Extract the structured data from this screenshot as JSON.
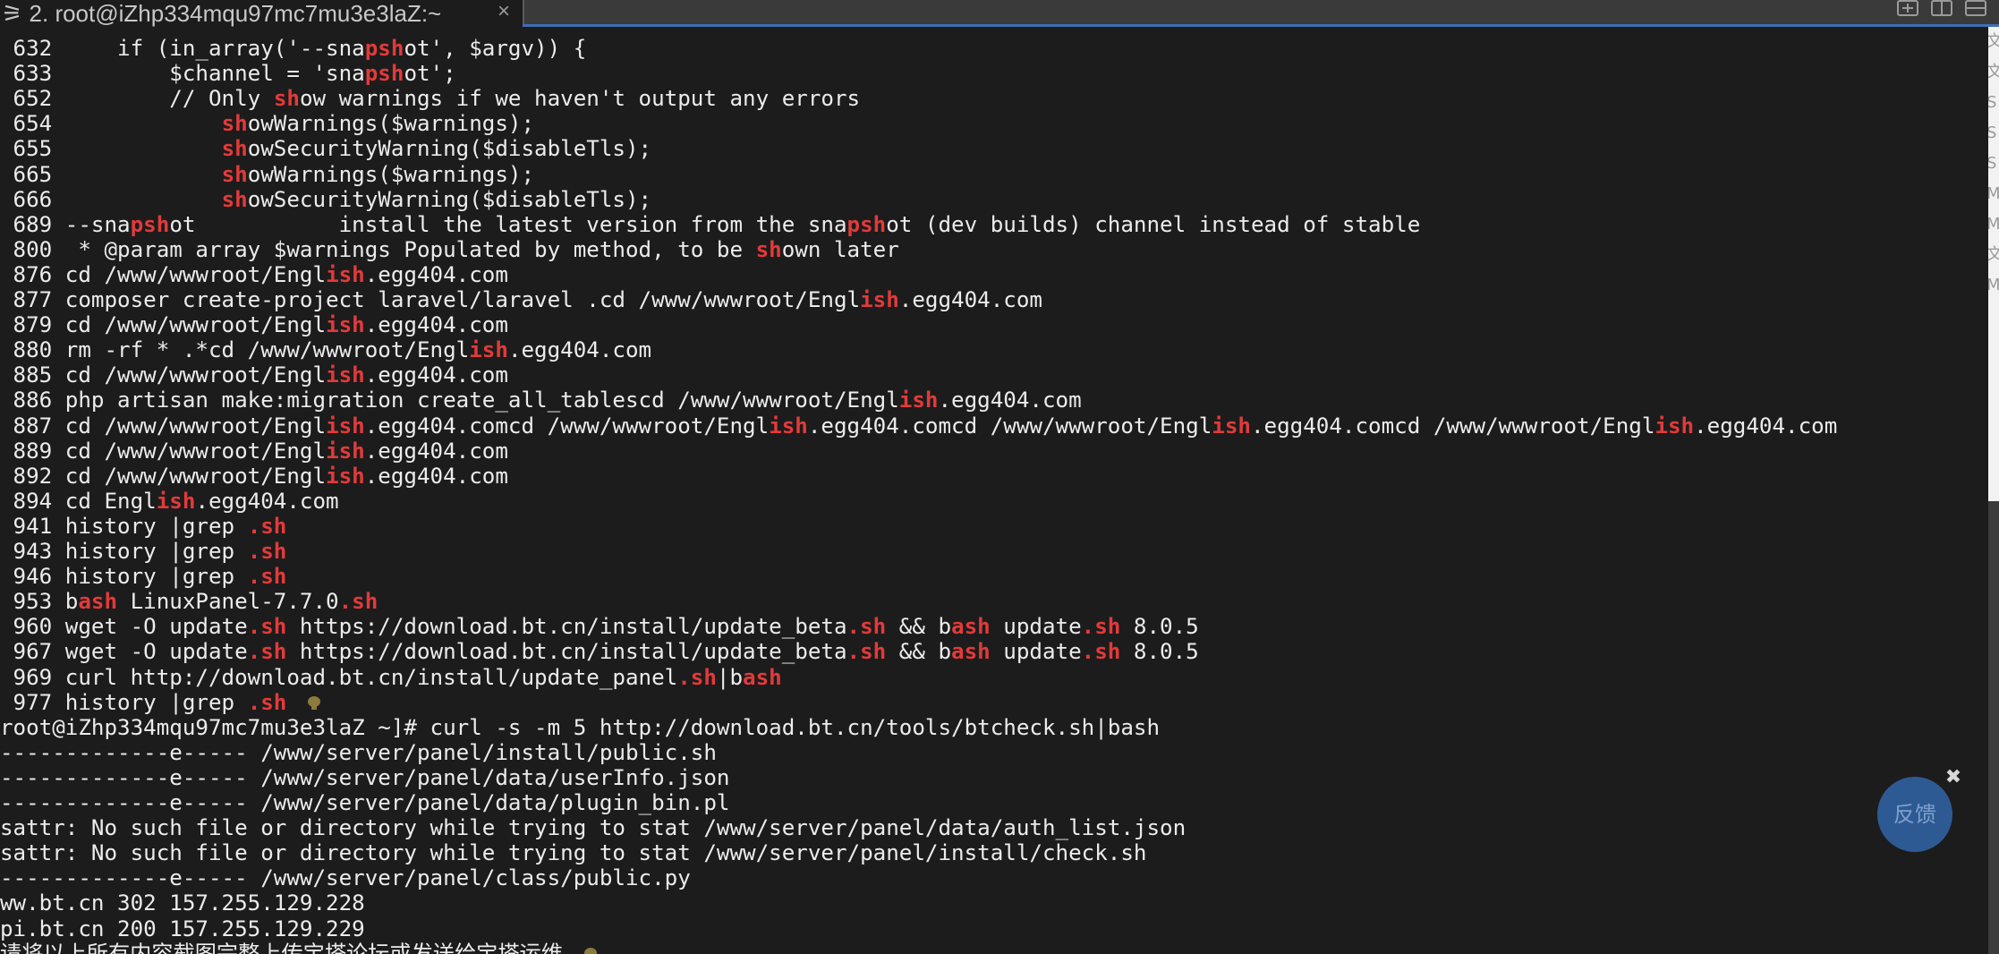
{
  "tab": {
    "prefix": "⚞",
    "title": " 2. root@iZhp334mqu97mc7mu3e3laZ:~",
    "close": "×"
  },
  "window_buttons": [
    "new-tab",
    "split-vertical",
    "split-horizontal"
  ],
  "terminal": {
    "history": [
      {
        "num": "632",
        "segments": [
          [
            "     if (in_array('--sna",
            0
          ],
          [
            "psh",
            1
          ],
          [
            "ot', $argv)) {",
            0
          ]
        ]
      },
      {
        "num": "633",
        "segments": [
          [
            "         $channel = 'sna",
            0
          ],
          [
            "psh",
            1
          ],
          [
            "ot';",
            0
          ]
        ]
      },
      {
        "num": "652",
        "segments": [
          [
            "         // Only ",
            0
          ],
          [
            "sh",
            1
          ],
          [
            "ow warnings if we haven't output any errors",
            0
          ]
        ]
      },
      {
        "num": "654",
        "segments": [
          [
            "             ",
            0
          ],
          [
            "sh",
            1
          ],
          [
            "owWarnings($warnings);",
            0
          ]
        ]
      },
      {
        "num": "655",
        "segments": [
          [
            "             ",
            0
          ],
          [
            "sh",
            1
          ],
          [
            "owSecurityWarning($disableTls);",
            0
          ]
        ]
      },
      {
        "num": "665",
        "segments": [
          [
            "             ",
            0
          ],
          [
            "sh",
            1
          ],
          [
            "owWarnings($warnings);",
            0
          ]
        ]
      },
      {
        "num": "666",
        "segments": [
          [
            "             ",
            0
          ],
          [
            "sh",
            1
          ],
          [
            "owSecurityWarning($disableTls);",
            0
          ]
        ]
      },
      {
        "num": "689",
        "segments": [
          [
            " --sna",
            0
          ],
          [
            "psh",
            1
          ],
          [
            "ot           install the latest version from the sna",
            0
          ],
          [
            "psh",
            1
          ],
          [
            "ot (dev builds) channel instead of stable",
            0
          ]
        ]
      },
      {
        "num": "800",
        "segments": [
          [
            "  * @param array $warnings Populated by method, to be ",
            0
          ],
          [
            "sh",
            1
          ],
          [
            "own later",
            0
          ]
        ]
      },
      {
        "num": "876",
        "segments": [
          [
            " cd /www/wwwroot/Engl",
            0
          ],
          [
            "ish",
            1
          ],
          [
            ".egg404.com",
            0
          ]
        ]
      },
      {
        "num": "877",
        "segments": [
          [
            " composer create-project laravel/laravel .cd /www/wwwroot/Engl",
            0
          ],
          [
            "ish",
            1
          ],
          [
            ".egg404.com",
            0
          ]
        ]
      },
      {
        "num": "879",
        "segments": [
          [
            " cd /www/wwwroot/Engl",
            0
          ],
          [
            "ish",
            1
          ],
          [
            ".egg404.com",
            0
          ]
        ]
      },
      {
        "num": "880",
        "segments": [
          [
            " rm -rf * .*cd /www/wwwroot/Engl",
            0
          ],
          [
            "ish",
            1
          ],
          [
            ".egg404.com",
            0
          ]
        ]
      },
      {
        "num": "885",
        "segments": [
          [
            " cd /www/wwwroot/Engl",
            0
          ],
          [
            "ish",
            1
          ],
          [
            ".egg404.com",
            0
          ]
        ]
      },
      {
        "num": "886",
        "segments": [
          [
            " php artisan make:migration create_all_tablescd /www/wwwroot/Engl",
            0
          ],
          [
            "ish",
            1
          ],
          [
            ".egg404.com",
            0
          ]
        ]
      },
      {
        "num": "887",
        "segments": [
          [
            " cd /www/wwwroot/Engl",
            0
          ],
          [
            "ish",
            1
          ],
          [
            ".egg404.comcd /www/wwwroot/Engl",
            0
          ],
          [
            "ish",
            1
          ],
          [
            ".egg404.comcd /www/wwwroot/Engl",
            0
          ],
          [
            "ish",
            1
          ],
          [
            ".egg404.comcd /www/wwwroot/Engl",
            0
          ],
          [
            "ish",
            1
          ],
          [
            ".egg404.com",
            0
          ]
        ]
      },
      {
        "num": "889",
        "segments": [
          [
            " cd /www/wwwroot/Engl",
            0
          ],
          [
            "ish",
            1
          ],
          [
            ".egg404.com",
            0
          ]
        ]
      },
      {
        "num": "892",
        "segments": [
          [
            " cd /www/wwwroot/Engl",
            0
          ],
          [
            "ish",
            1
          ],
          [
            ".egg404.com",
            0
          ]
        ]
      },
      {
        "num": "894",
        "segments": [
          [
            " cd Engl",
            0
          ],
          [
            "ish",
            1
          ],
          [
            ".egg404.com",
            0
          ]
        ]
      },
      {
        "num": "941",
        "segments": [
          [
            " history |grep ",
            0
          ],
          [
            ".sh",
            1
          ]
        ]
      },
      {
        "num": "943",
        "segments": [
          [
            " history |grep ",
            0
          ],
          [
            ".sh",
            1
          ]
        ]
      },
      {
        "num": "946",
        "segments": [
          [
            " history |grep ",
            0
          ],
          [
            ".sh",
            1
          ]
        ]
      },
      {
        "num": "953",
        "segments": [
          [
            " b",
            0
          ],
          [
            "ash",
            1
          ],
          [
            " LinuxPanel-7.7.0",
            0
          ],
          [
            ".sh",
            1
          ]
        ]
      },
      {
        "num": "960",
        "segments": [
          [
            " wget -O update",
            0
          ],
          [
            ".sh",
            1
          ],
          [
            " https://download.bt.cn/install/update_beta",
            0
          ],
          [
            ".sh",
            1
          ],
          [
            " && b",
            0
          ],
          [
            "ash",
            1
          ],
          [
            " update",
            0
          ],
          [
            ".sh",
            1
          ],
          [
            " 8.0.5",
            0
          ]
        ]
      },
      {
        "num": "967",
        "segments": [
          [
            " wget -O update",
            0
          ],
          [
            ".sh",
            1
          ],
          [
            " https://download.bt.cn/install/update_beta",
            0
          ],
          [
            ".sh",
            1
          ],
          [
            " && b",
            0
          ],
          [
            "ash",
            1
          ],
          [
            " update",
            0
          ],
          [
            ".sh",
            1
          ],
          [
            " 8.0.5",
            0
          ]
        ]
      },
      {
        "num": "969",
        "segments": [
          [
            " curl http://download.bt.cn/install/update_panel",
            0
          ],
          [
            ".sh",
            1
          ],
          [
            "|b",
            0
          ],
          [
            "ash",
            1
          ]
        ]
      },
      {
        "num": "977",
        "segments": [
          [
            " history |grep ",
            0
          ],
          [
            ".sh",
            1
          ]
        ]
      }
    ],
    "output": [
      "root@iZhp334mqu97mc7mu3e3laZ ~]# curl -s -m 5 http://download.bt.cn/tools/btcheck.sh|bash",
      "-------------e----- /www/server/panel/install/public.sh",
      "-------------e----- /www/server/panel/data/userInfo.json",
      "-------------e----- /www/server/panel/data/plugin_bin.pl",
      "sattr: No such file or directory while trying to stat /www/server/panel/data/auth_list.json",
      "sattr: No such file or directory while trying to stat /www/server/panel/install/check.sh",
      "-------------e----- /www/server/panel/class/public.py",
      "ww.bt.cn 302 157.255.129.228",
      "pi.bt.cn 200 157.255.129.229",
      "请将以上所有内容截图完整上传宝塔论坛或发送给宝塔运维"
    ]
  },
  "side_strip_chars": [
    "文",
    "文",
    "S",
    "S",
    "S",
    "M",
    "M",
    "文",
    "M"
  ],
  "feedback": {
    "label": "反馈",
    "close": "✖"
  }
}
